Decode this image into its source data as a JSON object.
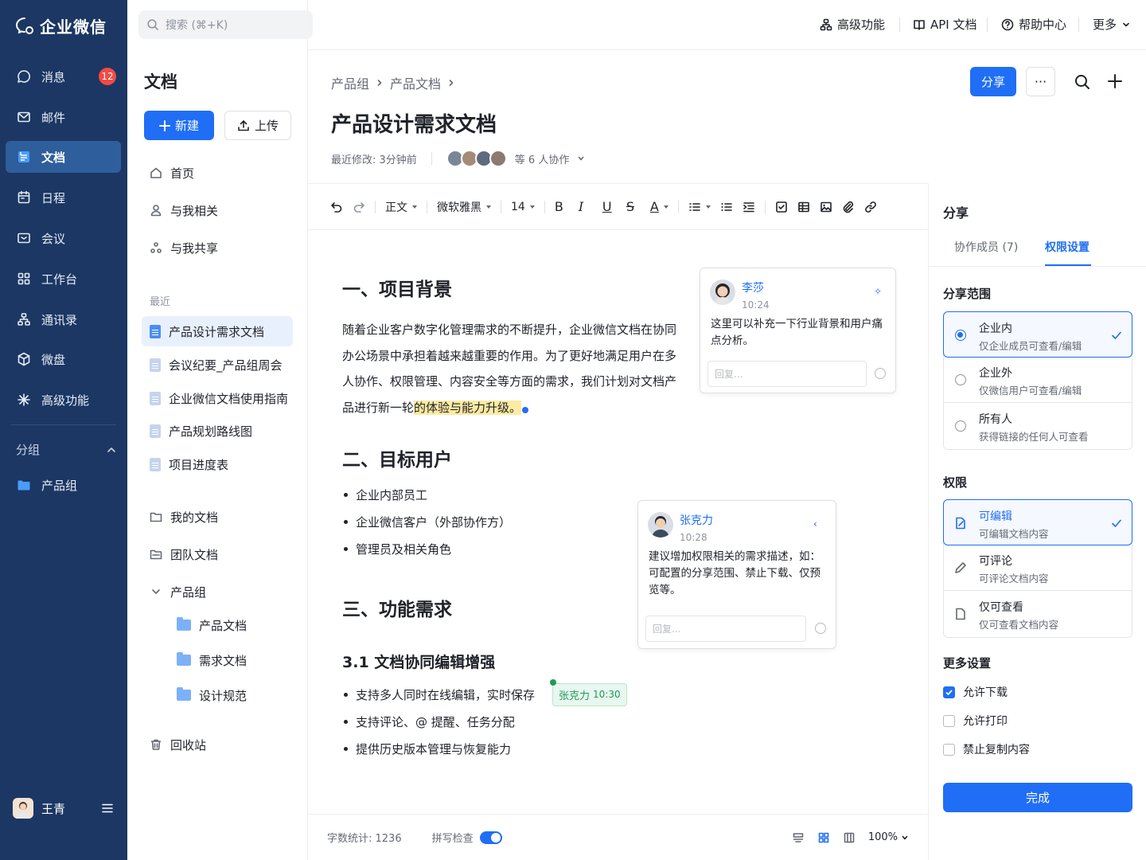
{
  "app": {
    "name": "企业微信",
    "badge_count": "12"
  },
  "nav": {
    "items": [
      {
        "label": "消息",
        "icon": "chat-icon"
      },
      {
        "label": "邮件",
        "icon": "mail-icon"
      },
      {
        "label": "文档",
        "icon": "doc-icon"
      },
      {
        "label": "日程",
        "icon": "calendar-icon"
      },
      {
        "label": "会议",
        "icon": "meeting-icon"
      },
      {
        "label": "工作台",
        "icon": "grid-icon"
      },
      {
        "label": "通讯录",
        "icon": "contacts-icon"
      },
      {
        "label": "微盘",
        "icon": "drive-icon"
      },
      {
        "label": "高级功能",
        "icon": "sparkle-icon"
      }
    ],
    "group_header": "分组",
    "group_item": "产品组",
    "user": "王青"
  },
  "topbar": {
    "search_placeholder": "搜索 (⌘+K)",
    "links": [
      "高级功能",
      "API 文档",
      "帮助中心",
      "更多"
    ]
  },
  "docnav": {
    "title": "文档",
    "new_label": "新建",
    "upload_label": "上传",
    "quick": [
      "首页",
      "与我相关",
      "与我共享"
    ],
    "recent_label": "最近",
    "recent": [
      "产品设计需求文档",
      "会议纪要_产品组周会",
      "企业微信文档使用指南",
      "产品规划路线图",
      "项目进度表"
    ],
    "my_docs": "我的文档",
    "team_docs": "团队文档",
    "group": "产品组",
    "folders": [
      "产品文档",
      "需求文档",
      "设计规范"
    ],
    "trash": "回收站"
  },
  "doc": {
    "breadcrumb": [
      "产品组",
      "产品文档"
    ],
    "title": "产品设计需求文档",
    "modified": "最近修改: 3分钟前",
    "collaborators": "等 6 人协作",
    "share_label": "分享",
    "more_label": "···"
  },
  "toolbar": {
    "style": "正文",
    "font": "微软雅黑",
    "size": "14",
    "bold": "B",
    "italic": "I",
    "underline": "U",
    "strike": "S",
    "color": "A"
  },
  "content": {
    "h1": "一、项目背景",
    "p1_a": "随着企业客户数字化管理需求的不断提升，企业微信文档在协同办公场景中承担着越来越重要的作用。为了更好地满足用户在多人协作、权限管理、内容安全等方面的需求，我们计划对文档产品进行新一轮",
    "p1_hl": "的体验与能力升级。",
    "h2": "二、目标用户",
    "users": [
      "企业内部员工",
      "企业微信客户（外部协作方）",
      "管理员及相关角色"
    ],
    "h3": "三、功能需求",
    "sub": "3.1 文档协同编辑增强",
    "features": [
      "支持多人同时在线编辑，实时保存",
      "支持评论、@ 提醒、任务分配",
      "提供历史版本管理与恢复能力"
    ],
    "mention_name": "张克力",
    "mention_time": "10:30"
  },
  "comments": [
    {
      "name": "李莎",
      "time": "10:24",
      "text": "这里可以补充一下行业背景和用户痛点分析。",
      "reply": "回复..."
    },
    {
      "name": "张克力",
      "time": "10:28",
      "text": "建议增加权限相关的需求描述，如：可配置的分享范围、禁止下载、仅预览等。",
      "reply": "回复..."
    }
  ],
  "status": {
    "words": "字数统计: 1236",
    "spell": "拼写检查",
    "spell_on": true,
    "zoom": "100%"
  },
  "panel": {
    "title": "分享",
    "tabs": [
      "协作成员 (7)",
      "权限设置"
    ],
    "scope_title": "分享范围",
    "scope": [
      {
        "t": "企业内",
        "s": "仅企业成员可查看/编辑"
      },
      {
        "t": "企业外",
        "s": "仅微信用户可查看/编辑"
      },
      {
        "t": "所有人",
        "s": "获得链接的任何人可查看"
      }
    ],
    "perm_title": "权限",
    "perms": [
      {
        "t": "可编辑",
        "s": "可编辑文档内容"
      },
      {
        "t": "可评论",
        "s": "可评论文档内容"
      },
      {
        "t": "仅可查看",
        "s": "仅可查看文档内容"
      }
    ],
    "more_title": "更多设置",
    "settings": [
      {
        "label": "允许下载",
        "on": true
      },
      {
        "label": "允许打印",
        "on": false
      },
      {
        "label": "禁止复制内容",
        "on": false
      }
    ],
    "done": "完成"
  },
  "colors": {
    "brand": "#1f6ef5",
    "sidebar": "#1c3763",
    "highlight": "#fdeaa3"
  }
}
